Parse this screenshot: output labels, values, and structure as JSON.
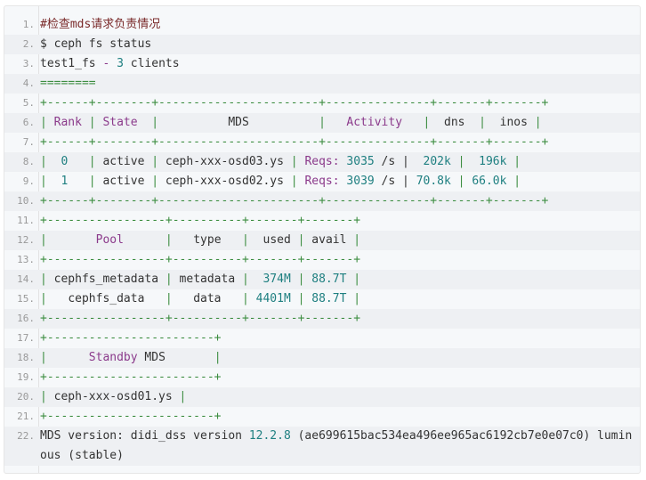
{
  "code": {
    "lines": [
      {
        "n": "1.",
        "segs": [
          {
            "t": "#检查mds请求负责情况",
            "c": "c-comment"
          }
        ]
      },
      {
        "n": "2.",
        "segs": [
          {
            "t": "$ ceph fs status",
            "c": "c-dark"
          }
        ]
      },
      {
        "n": "3.",
        "segs": [
          {
            "t": "test1_fs ",
            "c": "c-dark"
          },
          {
            "t": "-",
            "c": "c-purple"
          },
          {
            "t": " ",
            "c": "c-dark"
          },
          {
            "t": "3",
            "c": "c-teal"
          },
          {
            "t": " clients",
            "c": "c-dark"
          }
        ]
      },
      {
        "n": "4.",
        "segs": [
          {
            "t": "========",
            "c": "c-green"
          }
        ]
      },
      {
        "n": "5.",
        "segs": [
          {
            "t": "+------+--------+-----------------------+---------------+-------+-------+",
            "c": "c-green"
          }
        ]
      },
      {
        "n": "6.",
        "segs": [
          {
            "t": "| ",
            "c": "c-green"
          },
          {
            "t": "Rank",
            "c": "c-purple"
          },
          {
            "t": " | ",
            "c": "c-green"
          },
          {
            "t": "State",
            "c": "c-purple"
          },
          {
            "t": "  |          ",
            "c": "c-green"
          },
          {
            "t": "MDS",
            "c": "c-dark"
          },
          {
            "t": "          |   ",
            "c": "c-green"
          },
          {
            "t": "Activity",
            "c": "c-purple"
          },
          {
            "t": "   |  ",
            "c": "c-green"
          },
          {
            "t": "dns",
            "c": "c-dark"
          },
          {
            "t": "  |  ",
            "c": "c-green"
          },
          {
            "t": "inos",
            "c": "c-dark"
          },
          {
            "t": " |",
            "c": "c-green"
          }
        ]
      },
      {
        "n": "7.",
        "segs": [
          {
            "t": "+------+--------+-----------------------+---------------+-------+-------+",
            "c": "c-green"
          }
        ]
      },
      {
        "n": "8.",
        "segs": [
          {
            "t": "|  ",
            "c": "c-green"
          },
          {
            "t": "0",
            "c": "c-teal"
          },
          {
            "t": "   | ",
            "c": "c-green"
          },
          {
            "t": "active",
            "c": "c-dark"
          },
          {
            "t": " | ",
            "c": "c-green"
          },
          {
            "t": "ceph-xxx-osd03.ys",
            "c": "c-dark"
          },
          {
            "t": " | ",
            "c": "c-green"
          },
          {
            "t": "Reqs:",
            "c": "c-purple"
          },
          {
            "t": " ",
            "c": "c-dark"
          },
          {
            "t": "3035",
            "c": "c-teal"
          },
          {
            "t": " /s |  ",
            "c": "c-dark"
          },
          {
            "t": "202k",
            "c": "c-teal"
          },
          {
            "t": " |  ",
            "c": "c-green"
          },
          {
            "t": "196k",
            "c": "c-teal"
          },
          {
            "t": " |",
            "c": "c-green"
          }
        ]
      },
      {
        "n": "9.",
        "segs": [
          {
            "t": "|  ",
            "c": "c-green"
          },
          {
            "t": "1",
            "c": "c-teal"
          },
          {
            "t": "   | ",
            "c": "c-green"
          },
          {
            "t": "active",
            "c": "c-dark"
          },
          {
            "t": " | ",
            "c": "c-green"
          },
          {
            "t": "ceph-xxx-osd02.ys",
            "c": "c-dark"
          },
          {
            "t": " | ",
            "c": "c-green"
          },
          {
            "t": "Reqs:",
            "c": "c-purple"
          },
          {
            "t": " ",
            "c": "c-dark"
          },
          {
            "t": "3039",
            "c": "c-teal"
          },
          {
            "t": " /s | ",
            "c": "c-dark"
          },
          {
            "t": "70.8k",
            "c": "c-teal"
          },
          {
            "t": " | ",
            "c": "c-green"
          },
          {
            "t": "66.0k",
            "c": "c-teal"
          },
          {
            "t": " |",
            "c": "c-green"
          }
        ]
      },
      {
        "n": "10.",
        "segs": [
          {
            "t": "+------+--------+-----------------------+---------------+-------+-------+",
            "c": "c-green"
          }
        ]
      },
      {
        "n": "11.",
        "segs": [
          {
            "t": "+-----------------+----------+-------+-------+",
            "c": "c-green"
          }
        ]
      },
      {
        "n": "12.",
        "segs": [
          {
            "t": "|       ",
            "c": "c-green"
          },
          {
            "t": "Pool",
            "c": "c-purple"
          },
          {
            "t": "      |   ",
            "c": "c-green"
          },
          {
            "t": "type",
            "c": "c-dark"
          },
          {
            "t": "   |  ",
            "c": "c-green"
          },
          {
            "t": "used",
            "c": "c-dark"
          },
          {
            "t": " | ",
            "c": "c-green"
          },
          {
            "t": "avail",
            "c": "c-dark"
          },
          {
            "t": " |",
            "c": "c-green"
          }
        ]
      },
      {
        "n": "13.",
        "segs": [
          {
            "t": "+-----------------+----------+-------+-------+",
            "c": "c-green"
          }
        ]
      },
      {
        "n": "14.",
        "segs": [
          {
            "t": "| ",
            "c": "c-green"
          },
          {
            "t": "cephfs_metadata",
            "c": "c-dark"
          },
          {
            "t": " | ",
            "c": "c-green"
          },
          {
            "t": "metadata",
            "c": "c-dark"
          },
          {
            "t": " |  ",
            "c": "c-green"
          },
          {
            "t": "374M",
            "c": "c-teal"
          },
          {
            "t": " | ",
            "c": "c-green"
          },
          {
            "t": "88.7T",
            "c": "c-teal"
          },
          {
            "t": " |",
            "c": "c-green"
          }
        ]
      },
      {
        "n": "15.",
        "segs": [
          {
            "t": "|   ",
            "c": "c-green"
          },
          {
            "t": "cephfs_data",
            "c": "c-dark"
          },
          {
            "t": "   |   ",
            "c": "c-green"
          },
          {
            "t": "data",
            "c": "c-dark"
          },
          {
            "t": "   | ",
            "c": "c-green"
          },
          {
            "t": "4401M",
            "c": "c-teal"
          },
          {
            "t": " | ",
            "c": "c-green"
          },
          {
            "t": "88.7T",
            "c": "c-teal"
          },
          {
            "t": " |",
            "c": "c-green"
          }
        ]
      },
      {
        "n": "16.",
        "segs": [
          {
            "t": "+-----------------+----------+-------+-------+",
            "c": "c-green"
          }
        ]
      },
      {
        "n": "17.",
        "segs": [
          {
            "t": "+------------------------+",
            "c": "c-green"
          }
        ]
      },
      {
        "n": "18.",
        "segs": [
          {
            "t": "|      ",
            "c": "c-green"
          },
          {
            "t": "Standby",
            "c": "c-purple"
          },
          {
            "t": " ",
            "c": "c-dark"
          },
          {
            "t": "MDS",
            "c": "c-dark"
          },
          {
            "t": "       |",
            "c": "c-green"
          }
        ]
      },
      {
        "n": "19.",
        "segs": [
          {
            "t": "+------------------------+",
            "c": "c-green"
          }
        ]
      },
      {
        "n": "20.",
        "segs": [
          {
            "t": "| ",
            "c": "c-green"
          },
          {
            "t": "ceph-xxx-osd01.ys",
            "c": "c-dark"
          },
          {
            "t": " |",
            "c": "c-green"
          }
        ]
      },
      {
        "n": "21.",
        "segs": [
          {
            "t": "+------------------------+",
            "c": "c-green"
          }
        ]
      },
      {
        "n": "22.",
        "segs": [
          {
            "t": "MDS version: didi_dss version ",
            "c": "c-dark"
          },
          {
            "t": "12.2.8",
            "c": "c-teal"
          },
          {
            "t": " (ae699615bac534ea496ee965ac6192cb7e0e07c0) luminous (stable)",
            "c": "c-dark"
          }
        ]
      }
    ]
  }
}
